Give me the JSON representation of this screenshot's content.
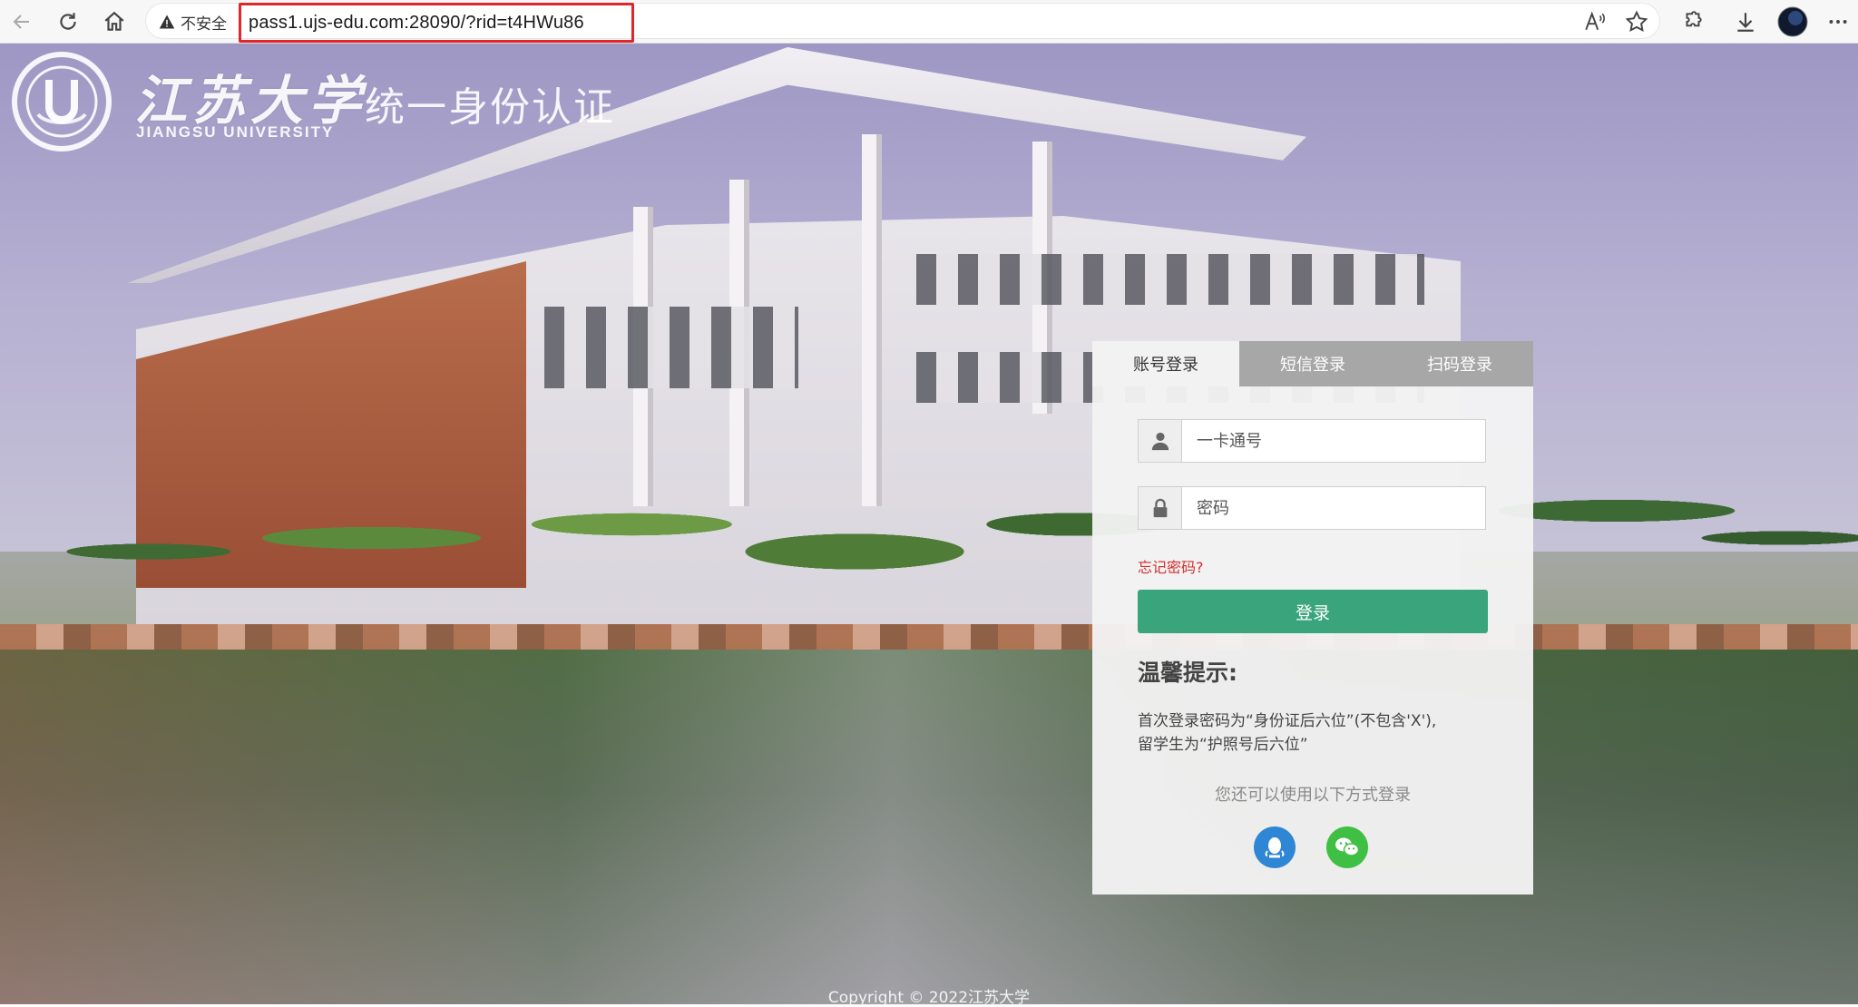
{
  "browser": {
    "insecure_label": "不安全",
    "url": "pass1.ujs-edu.com:28090/?rid=t4HWu86",
    "accent": "#e0262b"
  },
  "logo": {
    "name_cn": "江苏大学",
    "name_en": "JIANGSU UNIVERSITY",
    "subtitle": "统一身份认证"
  },
  "login": {
    "tabs": [
      {
        "label": "账号登录",
        "active": true
      },
      {
        "label": "短信登录",
        "active": false
      },
      {
        "label": "扫码登录",
        "active": false
      }
    ],
    "account_placeholder": "一卡通号",
    "password_placeholder": "密码",
    "forgot_label": "忘记密码?",
    "submit_label": "登录",
    "tips_title": "温馨提示:",
    "tips_text": "首次登录密码为“身份证后六位”(不包含'X'),留学生为“护照号后六位”",
    "alt_login_label": "您还可以使用以下方式登录",
    "alt_icons": [
      "qq-icon",
      "wechat-icon"
    ],
    "button_color": "#3aa57c"
  },
  "footer": {
    "copyright": "Copyright © 2022江苏大学"
  }
}
